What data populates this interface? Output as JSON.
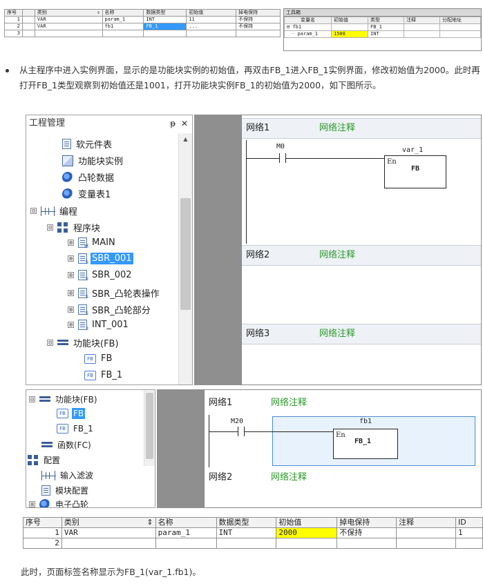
{
  "top_table": {
    "headers": [
      "序号",
      "类别",
      "名称",
      "数据类型",
      "初始值",
      "掉电保持"
    ],
    "sort_glyph": "⇕",
    "rows": [
      {
        "no": "1",
        "category": "VAR",
        "name": "param_1",
        "type": "INT",
        "init": "11",
        "retain": "不保持"
      },
      {
        "no": "2",
        "category": "VAR",
        "name": "fb1",
        "type": "FB_1",
        "init": "...",
        "retain": "不保持"
      },
      {
        "no": "3",
        "category": "",
        "name": "",
        "type": "",
        "init": "",
        "retain": ""
      }
    ]
  },
  "toolbox": {
    "title": "工具箱",
    "headers": [
      "变量名",
      "初始值",
      "类型",
      "注释",
      "分配地址"
    ],
    "rows": [
      {
        "expander": "⊟",
        "name": "fb1",
        "init": "",
        "type": "FB_1"
      },
      {
        "expander": "",
        "name": "param_1",
        "init": "1500",
        "type": "INT"
      }
    ]
  },
  "para1": "从主程序中进入实例界面，显示的是功能块实例的初始值，再双击FB_1进入FB_1实例界面，修改初始值为2000。此时再打开FB_1类型观察到初始值还是1001，打开功能块实例FB_1的初始值为2000，如下图所示。",
  "project_panel": {
    "title": "工程管理",
    "pin": "ᵽ",
    "close": "✕",
    "items": [
      {
        "label": "软元件表"
      },
      {
        "label": "功能块实例"
      },
      {
        "label": "凸轮数据"
      },
      {
        "label": "变量表1"
      },
      {
        "label": "编程",
        "expander": "⊟"
      },
      {
        "label": "程序块",
        "expander": "⊟"
      },
      {
        "label": "MAIN",
        "expander": "⊞",
        "sub": "M"
      },
      {
        "label": "SBR_001",
        "expander": "⊞",
        "sub": "S"
      },
      {
        "label": "SBR_002",
        "expander": "⊞",
        "sub": "S"
      },
      {
        "label": "SBR_凸轮表操作",
        "expander": "⊞",
        "sub": "S"
      },
      {
        "label": "SBR_凸轮部分",
        "expander": "⊞",
        "sub": "S"
      },
      {
        "label": "INT_001",
        "expander": "⊞",
        "sub": "I"
      },
      {
        "label": "功能块(FB)",
        "expander": "⊟"
      },
      {
        "label": "FB",
        "icon": "FB"
      },
      {
        "label": "FB_1",
        "icon": "FB"
      }
    ]
  },
  "ladder1": {
    "networks": [
      {
        "name": "网络1",
        "comment": "网络注释"
      },
      {
        "name": "网络2",
        "comment": "网络注释"
      },
      {
        "name": "网络3",
        "comment": "网络注释"
      }
    ],
    "contact": "M0",
    "instance": "var_1",
    "en": "En",
    "block": "FB"
  },
  "project_panel2": {
    "items": [
      {
        "label": "功能块(FB)",
        "expander": "⊟"
      },
      {
        "label": "FB",
        "icon": "FB"
      },
      {
        "label": "FB_1",
        "icon": "FB"
      },
      {
        "label": "函数(FC)"
      },
      {
        "label": "配置",
        "expander": "⊟"
      },
      {
        "label": "输入滤波"
      },
      {
        "label": "模块配置"
      },
      {
        "label": "电子凸轮",
        "expander": "⊞"
      }
    ]
  },
  "ladder2": {
    "networks": [
      {
        "name": "网络1",
        "comment": "网络注释"
      },
      {
        "name": "网络2",
        "comment": "网络注释"
      }
    ],
    "contact": "M20",
    "instance": "fb1",
    "en": "En",
    "block": "FB_1"
  },
  "bottom_table": {
    "headers": [
      "序号",
      "类别",
      "名称",
      "数据类型",
      "初始值",
      "掉电保持",
      "注释",
      "ID"
    ],
    "sort_glyph": "⇕",
    "rows": [
      {
        "no": "1",
        "category": "VAR",
        "name": "param_1",
        "type": "INT",
        "init": "2000",
        "retain": "不保持",
        "comment": "",
        "id": "1"
      },
      {
        "no": "2",
        "category": "",
        "name": "",
        "type": "",
        "init": "",
        "retain": "",
        "comment": "",
        "id": ""
      }
    ]
  },
  "para2": "此时，页面标签名称显示为FB_1(var_1.fb1)。"
}
